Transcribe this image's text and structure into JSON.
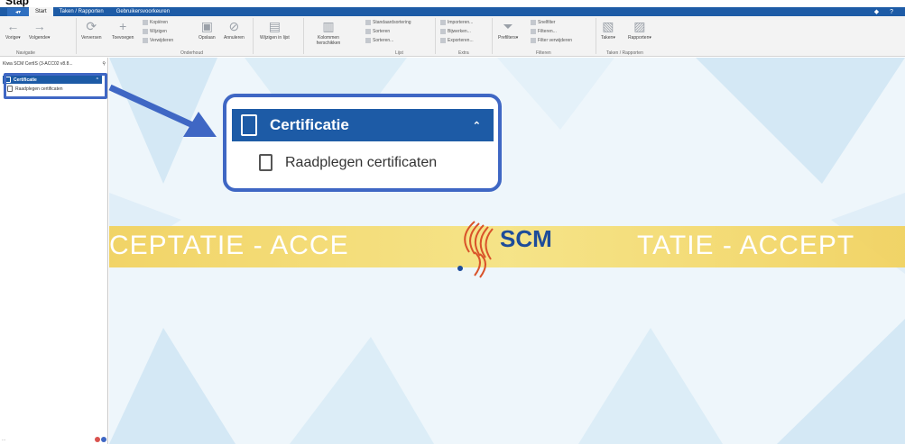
{
  "top_strip_text": "Stap",
  "titlebar": {
    "tabs": [
      {
        "label": "Start",
        "active": true
      },
      {
        "label": "Taken / Rapporten",
        "active": false
      },
      {
        "label": "Gebruikersvoorkeuren",
        "active": false
      }
    ],
    "help_icons": "◆ ?"
  },
  "ribbon": {
    "nav": {
      "vorige": "Vorige▾",
      "volgende": "Volgende▾",
      "group": "Navigatie"
    },
    "onderhoud": {
      "verversen": "Verversen",
      "toevoegen": "Toevoegen",
      "kopieren": "Kopiëren",
      "wijzigen": "Wijzigen",
      "verwijderen": "Verwijderen",
      "opslaan": "Opslaan",
      "annuleren": "Annuleren",
      "group": "Onderhoud"
    },
    "wijzigen_in_lijst": "Wijzigen in lijst",
    "lijst": {
      "kolommen": "Kolommen herschikken",
      "standaardsortering": "Standaardsortering",
      "sorteren": "Sorteren",
      "sorteren2": "Sorteren...",
      "group": "Lijst"
    },
    "extra": {
      "importeren": "Importeren...",
      "bijwerken": "Bijwerken...",
      "exporteren": "Exporteren...",
      "group": "Extra"
    },
    "filteren": {
      "prefilters": "Prefilters▾",
      "snelfilter": "Snelfilter",
      "filteren": "Filteren...",
      "filter_verwijderen": "Filter verwijderen",
      "group": "Filteren"
    },
    "taken": {
      "taken": "Taken▾",
      "rapporten": "Rapporten▾",
      "group": "Taken / Rapporten"
    }
  },
  "navpane": {
    "header": "Kiwa SCM CertIS (3-ACC02 v8.8...",
    "pin": "⚲",
    "section": "Certificatie",
    "item": "Raadplegen certificaten",
    "footer_left": "...",
    "footer_dots": [
      "#d9534f",
      "#3f67c4"
    ]
  },
  "main": {
    "banner_left": "CEPTATIE - ACCE",
    "banner_right": "TATIE - ACCEPT",
    "logo": "SCM"
  },
  "callout": {
    "section": "Certificatie",
    "item": "Raadplegen certificaten"
  },
  "colors": {
    "accent": "#1d5ba6",
    "highlight": "#3f67c4",
    "banner": "#f2d15a"
  }
}
